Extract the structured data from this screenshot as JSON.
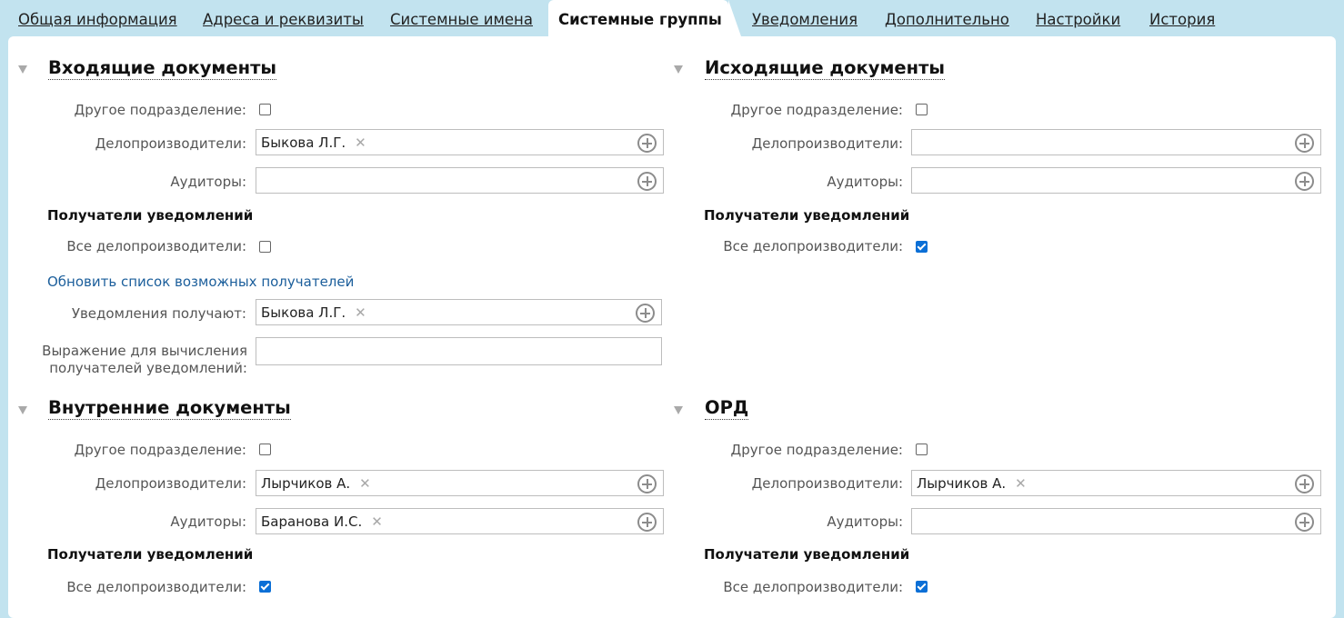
{
  "tabs": [
    {
      "label": "Общая информация"
    },
    {
      "label": "Адреса и реквизиты"
    },
    {
      "label": "Системные имена"
    },
    {
      "label": "Системные группы",
      "active": true
    },
    {
      "label": "Уведомления"
    },
    {
      "label": "Дополнительно"
    },
    {
      "label": "Настройки"
    },
    {
      "label": "История"
    }
  ],
  "labels": {
    "other_division": "Другое подразделение:",
    "clerks": "Делопроизводители:",
    "auditors": "Аудиторы:",
    "recipients_heading": "Получатели уведомлений",
    "all_clerks": "Все делопроизводители:",
    "refresh_link": "Обновить список возможных получателей",
    "notified": "Уведомления получают:",
    "expression": "Выражение для вычисления получателей уведомлений:"
  },
  "sections": {
    "incoming": {
      "title": "Входящие документы",
      "other_division_checked": false,
      "clerks": [
        "Быкова Л.Г."
      ],
      "auditors": [],
      "all_clerks_checked": false,
      "notified": [
        "Быкова Л.Г."
      ],
      "expression": ""
    },
    "outgoing": {
      "title": "Исходящие документы",
      "other_division_checked": false,
      "clerks": [],
      "auditors": [],
      "all_clerks_checked": true
    },
    "internal": {
      "title": "Внутренние документы",
      "other_division_checked": false,
      "clerks": [
        "Лырчиков А."
      ],
      "auditors": [
        "Баранова И.С."
      ],
      "all_clerks_checked": true
    },
    "ord": {
      "title": "ОРД",
      "other_division_checked": false,
      "clerks": [
        "Лырчиков А."
      ],
      "auditors": [],
      "all_clerks_checked": true
    }
  },
  "icons": {
    "remove": "close-x-icon",
    "add": "plus-circle-icon",
    "collapse": "triangle-down-icon"
  },
  "colors": {
    "background": "#c2e3ef",
    "link": "#1b5e9b",
    "checkbox_checked": "#0b6fd6"
  }
}
